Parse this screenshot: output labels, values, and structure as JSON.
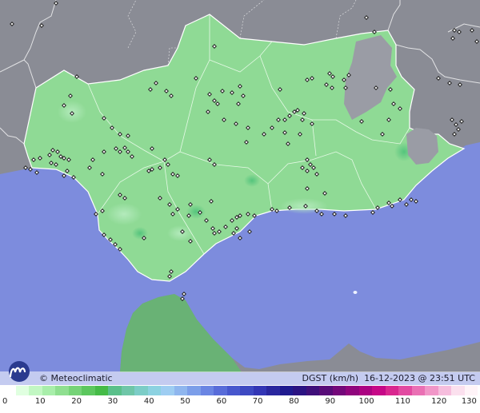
{
  "map": {
    "land_color": "#8a8c95",
    "sea_color": "#7d8cdd",
    "region_color": "#8fda95",
    "station_count": 180
  },
  "branding": {
    "copyright_name": "© Meteoclimatic",
    "logo_icon": "meteoclimatic-logo-icon"
  },
  "caption": {
    "variable": "DGST (km/h)",
    "datetime": "16-12-2023 @ 23:51 UTC"
  },
  "legend": {
    "colors": [
      "#ffffff",
      "#e0ffe0",
      "#c2f7c3",
      "#a8eeaa",
      "#8fdf90",
      "#75d377",
      "#5cc75e",
      "#45bb47",
      "#5ac08a",
      "#6fc6a8",
      "#7ccdc7",
      "#8cd2e1",
      "#9ecdf2",
      "#8fb6ee",
      "#7c9ee9",
      "#6a85e3",
      "#586cd9",
      "#4757cd",
      "#3d49c2",
      "#3336b5",
      "#2a279f",
      "#1f1a8f",
      "#2b1382",
      "#3f0f7a",
      "#580c78",
      "#74087a",
      "#90057d",
      "#ab0382",
      "#c60887",
      "#d9278f",
      "#e24aa1",
      "#ea70b4",
      "#f196c8",
      "#f6bddd",
      "#fbe0ee",
      "#fff4f8"
    ],
    "labels": [
      "0",
      "10",
      "20",
      "30",
      "40",
      "50",
      "60",
      "70",
      "80",
      "90",
      "100",
      "110",
      "120",
      "130"
    ]
  }
}
